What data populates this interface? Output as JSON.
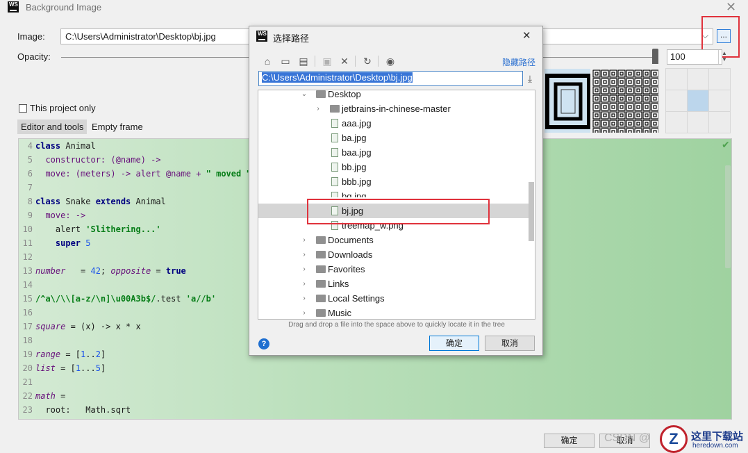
{
  "window": {
    "logo_text": "WS",
    "title": "Background Image",
    "close_glyph": "✕"
  },
  "image_row": {
    "label": "Image:",
    "value": "C:\\Users\\Administrator\\Desktop\\bj.jpg",
    "dropdown_glyph": "⌵",
    "browse_label": "..."
  },
  "opacity_row": {
    "label": "Opacity:",
    "value": "100",
    "level_percent": 100
  },
  "options": {
    "project_only_label": "This project only",
    "tabs": [
      "Editor and tools",
      "Empty frame"
    ]
  },
  "editor": {
    "lines": [
      {
        "num": "4",
        "top": 0
      },
      {
        "num": "5"
      },
      {
        "num": "6"
      },
      {
        "num": "7"
      },
      {
        "num": "8"
      },
      {
        "num": "9"
      },
      {
        "num": "10"
      },
      {
        "num": "11"
      },
      {
        "num": "12"
      },
      {
        "num": "13"
      },
      {
        "num": "14"
      },
      {
        "num": "15"
      },
      {
        "num": "16"
      },
      {
        "num": "17"
      },
      {
        "num": "18"
      },
      {
        "num": "19"
      },
      {
        "num": "20"
      },
      {
        "num": "21"
      },
      {
        "num": "22"
      },
      {
        "num": "23"
      }
    ],
    "code": {
      "l4_a": "class",
      "l4_b": " Animal",
      "l5": "  constructor: (@name) ->",
      "l6_a": "  move: (meters) -> alert @name + ",
      "l6_b": "\" moved \"",
      "l8_a": "class",
      "l8_b": " Snake ",
      "l8_c": "extends",
      "l8_d": " Animal",
      "l9": "  move: ->",
      "l10_a": "    alert ",
      "l10_b": "'Slithering...'",
      "l11_a": "    super",
      "l11_b": " 5",
      "l13_a": "number",
      "l13_b": "   = ",
      "l13_c": "42",
      "l13_d": "; ",
      "l13_e": "opposite",
      "l13_f": " = ",
      "l13_g": "true",
      "l15_a": "/^a\\/\\\\[a-z/\\n]\\u00A3b$/",
      "l15_b": ".test ",
      "l15_c": "'a//b'",
      "l17_a": "square",
      "l17_b": " = (x) -> x * x",
      "l19_a": "range",
      "l19_b": " = [",
      "l19_c": "1",
      "l19_d": "..",
      "l19_e": "2",
      "l19_f": "]",
      "l20_a": "list",
      "l20_b": " = [",
      "l20_c": "1",
      "l20_d": "...",
      "l20_e": "5",
      "l20_f": "]",
      "l22_a": "math",
      "l22_b": " =",
      "l23": "  root:   Math.sqrt"
    },
    "check_glyph": "✔"
  },
  "footer": {
    "ok_label": "确定",
    "cancel_label": "取消",
    "watermark": "CSDN @"
  },
  "site_logo": {
    "glyph": "Z",
    "name": "这里下载站",
    "url_text": "heredown.com"
  },
  "dialog": {
    "logo_text": "WS",
    "title": "选择路径",
    "close_glyph": "✕",
    "hide_path_link": "隐藏路径",
    "path_value": "C:\\Users\\Administrator\\Desktop\\bj.jpg",
    "download_glyph": "⤓",
    "toolbar": {
      "home": "⌂",
      "desktop": "▭",
      "project": "▤",
      "new_folder": "▣",
      "delete": "✕",
      "refresh": "↻",
      "show_hidden": "◉"
    },
    "tree": [
      {
        "label": "Desktop",
        "type": "folder",
        "level": 0,
        "expanded": true
      },
      {
        "label": "jetbrains-in-chinese-master",
        "type": "folder",
        "level": 1,
        "expanded": false
      },
      {
        "label": "aaa.jpg",
        "type": "file",
        "level": 1
      },
      {
        "label": "ba.jpg",
        "type": "file",
        "level": 1
      },
      {
        "label": "baa.jpg",
        "type": "file",
        "level": 1
      },
      {
        "label": "bb.jpg",
        "type": "file",
        "level": 1
      },
      {
        "label": "bbb.jpg",
        "type": "file",
        "level": 1
      },
      {
        "label": "bg.jpg",
        "type": "file",
        "level": 1
      },
      {
        "label": "bj.jpg",
        "type": "file",
        "level": 1,
        "selected": true
      },
      {
        "label": "treemap_w.png",
        "type": "file",
        "level": 1
      },
      {
        "label": "Documents",
        "type": "folder",
        "level": 0,
        "expanded": false
      },
      {
        "label": "Downloads",
        "type": "folder",
        "level": 0,
        "expanded": false
      },
      {
        "label": "Favorites",
        "type": "folder",
        "level": 0,
        "expanded": false
      },
      {
        "label": "Links",
        "type": "folder",
        "level": 0,
        "expanded": false
      },
      {
        "label": "Local Settings",
        "type": "folder",
        "level": 0,
        "expanded": false
      },
      {
        "label": "Music",
        "type": "folder",
        "level": 0,
        "expanded": false
      }
    ],
    "hint": "Drag and drop a file into the space above to quickly locate it in the tree",
    "help_glyph": "?",
    "ok_label": "确定",
    "cancel_label": "取消"
  },
  "colors": {
    "highlight_box": "#e0323c",
    "selection": "#3875d7",
    "editor_green": "#b9dfba"
  }
}
